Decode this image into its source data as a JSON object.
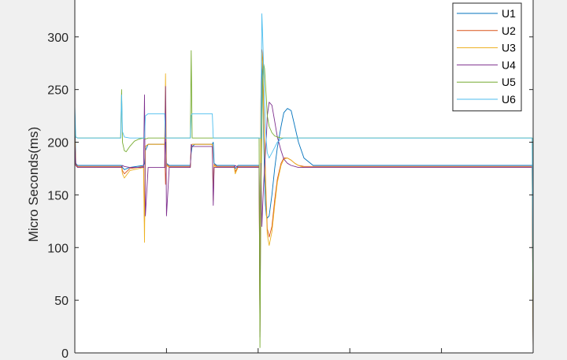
{
  "chart_data": {
    "type": "line",
    "ylabel": "Micro Seconds(ms)",
    "xlabel": "",
    "title": "",
    "xlim": [
      0,
      500
    ],
    "ylim": [
      0,
      335
    ],
    "yticks": [
      0,
      50,
      100,
      150,
      200,
      250,
      300
    ],
    "xticks_unlabeled": [
      0,
      100,
      200,
      300,
      400,
      500
    ],
    "grid": false,
    "legend_position": "top-right",
    "series": [
      {
        "name": "U1",
        "color": "#0072BD",
        "x": [
          0,
          1,
          3,
          20,
          50,
          51,
          52,
          54,
          60,
          75,
          76,
          77,
          80,
          98,
          99,
          100,
          103,
          120,
          126,
          127,
          128,
          131,
          150,
          151,
          152,
          155,
          173,
          174,
          175,
          178,
          200,
          201,
          202,
          203,
          204,
          205,
          206,
          207,
          208,
          209,
          210,
          212,
          215,
          218,
          221,
          225,
          228,
          232,
          236,
          240,
          244,
          250,
          260,
          300,
          350,
          400,
          450,
          498,
          499,
          500
        ],
        "y": [
          230,
          180,
          178,
          178,
          178,
          178,
          176,
          174,
          176,
          178,
          180,
          192,
          198,
          198,
          200,
          180,
          178,
          178,
          178,
          190,
          196,
          198,
          198,
          200,
          180,
          178,
          178,
          178,
          175,
          178,
          178,
          178,
          80,
          200,
          260,
          280,
          210,
          165,
          140,
          130,
          128,
          130,
          150,
          175,
          195,
          215,
          228,
          232,
          230,
          215,
          200,
          185,
          178,
          178,
          178,
          178,
          178,
          178,
          178,
          0
        ]
      },
      {
        "name": "U2",
        "color": "#D95319",
        "x": [
          0,
          1,
          3,
          20,
          50,
          51,
          52,
          54,
          60,
          75,
          76,
          77,
          80,
          98,
          99,
          100,
          103,
          120,
          126,
          127,
          128,
          131,
          150,
          151,
          152,
          155,
          173,
          174,
          175,
          178,
          200,
          201,
          202,
          203,
          204,
          205,
          206,
          207,
          208,
          209,
          210,
          212,
          215,
          218,
          221,
          225,
          228,
          232,
          236,
          240,
          244,
          250,
          260,
          300,
          350,
          400,
          450,
          498,
          499,
          500
        ],
        "y": [
          210,
          179,
          177,
          177,
          177,
          177,
          173,
          170,
          175,
          177,
          120,
          196,
          198,
          198,
          160,
          179,
          177,
          177,
          177,
          196,
          198,
          198,
          198,
          150,
          179,
          177,
          177,
          177,
          172,
          177,
          177,
          177,
          20,
          240,
          288,
          280,
          230,
          200,
          170,
          140,
          118,
          110,
          120,
          145,
          165,
          180,
          185,
          185,
          183,
          180,
          178,
          177,
          177,
          177,
          177,
          177,
          177,
          177,
          177,
          0
        ]
      },
      {
        "name": "U3",
        "color": "#EDB120",
        "x": [
          0,
          1,
          3,
          20,
          50,
          51,
          52,
          54,
          60,
          75,
          76,
          77,
          80,
          98,
          99,
          100,
          103,
          120,
          126,
          127,
          128,
          131,
          150,
          151,
          152,
          155,
          173,
          174,
          175,
          178,
          200,
          201,
          202,
          203,
          204,
          205,
          206,
          207,
          208,
          209,
          210,
          212,
          215,
          218,
          221,
          225,
          228,
          232,
          236,
          240,
          244,
          250,
          260,
          300,
          350,
          400,
          450,
          498,
          499,
          500
        ],
        "y": [
          205,
          178,
          176,
          176,
          176,
          176,
          170,
          166,
          173,
          176,
          105,
          196,
          198,
          198,
          265,
          178,
          176,
          176,
          176,
          196,
          198,
          198,
          198,
          145,
          178,
          176,
          176,
          176,
          170,
          176,
          176,
          176,
          30,
          230,
          285,
          275,
          225,
          195,
          165,
          135,
          112,
          102,
          115,
          140,
          162,
          178,
          184,
          185,
          183,
          180,
          178,
          176,
          176,
          176,
          176,
          176,
          176,
          176,
          176,
          0
        ]
      },
      {
        "name": "U4",
        "color": "#7E2F8E",
        "x": [
          0,
          1,
          3,
          20,
          50,
          51,
          52,
          54,
          60,
          75,
          76,
          77,
          80,
          98,
          99,
          100,
          103,
          120,
          126,
          127,
          128,
          131,
          150,
          151,
          152,
          155,
          173,
          174,
          175,
          178,
          200,
          201,
          202,
          203,
          204,
          205,
          206,
          207,
          208,
          209,
          210,
          212,
          215,
          218,
          221,
          225,
          228,
          232,
          236,
          240,
          244,
          250,
          260,
          300,
          350,
          400,
          450,
          498,
          499,
          500
        ],
        "y": [
          200,
          178,
          176,
          176,
          176,
          176,
          178,
          177,
          176,
          176,
          245,
          130,
          176,
          176,
          253,
          130,
          176,
          176,
          176,
          198,
          196,
          196,
          196,
          140,
          176,
          176,
          176,
          176,
          178,
          176,
          176,
          176,
          15,
          180,
          120,
          140,
          160,
          175,
          190,
          205,
          225,
          238,
          235,
          220,
          205,
          192,
          184,
          180,
          178,
          177,
          176,
          176,
          176,
          176,
          176,
          176,
          176,
          176,
          176,
          0
        ]
      },
      {
        "name": "U5",
        "color": "#77AC30",
        "x": [
          0,
          1,
          3,
          20,
          50,
          51,
          52,
          54,
          56,
          60,
          65,
          70,
          75,
          76,
          77,
          80,
          98,
          99,
          100,
          103,
          120,
          126,
          127,
          128,
          131,
          150,
          151,
          152,
          155,
          173,
          174,
          175,
          178,
          200,
          201,
          202,
          203,
          204,
          205,
          206,
          207,
          208,
          209,
          210,
          212,
          215,
          218,
          221,
          225,
          228,
          232,
          236,
          240,
          244,
          250,
          260,
          300,
          350,
          400,
          450,
          498,
          499,
          500
        ],
        "y": [
          220,
          205,
          204,
          204,
          204,
          250,
          200,
          192,
          191,
          196,
          201,
          203,
          204,
          204,
          203,
          204,
          204,
          204,
          204,
          204,
          204,
          204,
          287,
          204,
          204,
          204,
          204,
          204,
          204,
          204,
          204,
          204,
          204,
          204,
          204,
          5,
          150,
          210,
          260,
          274,
          270,
          255,
          240,
          225,
          215,
          209,
          206,
          205,
          204,
          204,
          204,
          204,
          204,
          204,
          204,
          204,
          204,
          204,
          204,
          204,
          204,
          204,
          0
        ]
      },
      {
        "name": "U6",
        "color": "#4DBEEE",
        "x": [
          0,
          1,
          3,
          20,
          50,
          51,
          52,
          54,
          60,
          75,
          76,
          77,
          80,
          98,
          99,
          100,
          103,
          120,
          126,
          127,
          128,
          131,
          150,
          151,
          152,
          155,
          173,
          174,
          175,
          178,
          200,
          201,
          202,
          203,
          204,
          205,
          206,
          207,
          208,
          209,
          210,
          212,
          215,
          218,
          221,
          225,
          228,
          232,
          236,
          240,
          244,
          250,
          260,
          300,
          350,
          400,
          450,
          498,
          499,
          500
        ],
        "y": [
          235,
          205,
          204,
          204,
          204,
          245,
          210,
          205,
          204,
          204,
          204,
          225,
          227,
          227,
          204,
          204,
          204,
          204,
          204,
          225,
          227,
          227,
          227,
          204,
          204,
          204,
          204,
          204,
          204,
          204,
          204,
          204,
          204,
          204,
          322,
          300,
          270,
          240,
          215,
          200,
          190,
          185,
          190,
          195,
          200,
          203,
          204,
          204,
          204,
          204,
          204,
          204,
          204,
          204,
          204,
          204,
          204,
          204,
          204,
          60
        ]
      }
    ]
  }
}
